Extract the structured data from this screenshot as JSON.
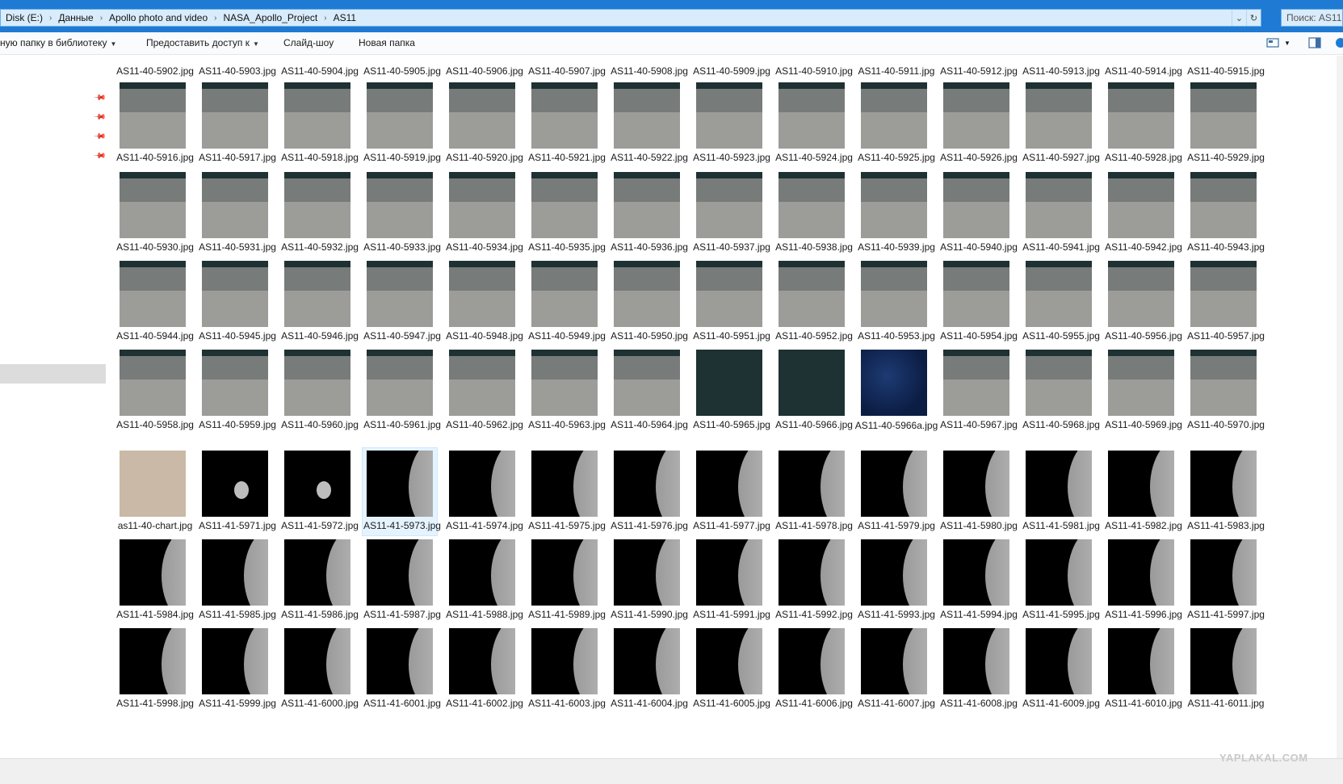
{
  "address": {
    "crumbs": [
      "Disk (E:)",
      "Данные",
      "Apollo photo and video",
      "NASA_Apollo_Project",
      "AS11"
    ],
    "search_placeholder": "Поиск: AS11"
  },
  "toolbar": {
    "include_library": "ную папку в библиотеку",
    "share": "Предоставить доступ к",
    "slideshow": "Слайд-шоу",
    "new_folder": "Новая папка"
  },
  "rows": [
    {
      "files": [
        "AS11-40-5902.jpg",
        "AS11-40-5903.jpg",
        "AS11-40-5904.jpg",
        "AS11-40-5905.jpg",
        "AS11-40-5906.jpg",
        "AS11-40-5907.jpg",
        "AS11-40-5908.jpg",
        "AS11-40-5909.jpg",
        "AS11-40-5910.jpg",
        "AS11-40-5911.jpg",
        "AS11-40-5912.jpg",
        "AS11-40-5913.jpg",
        "AS11-40-5914.jpg",
        "AS11-40-5915.jpg"
      ],
      "kind": "lunar"
    },
    {
      "files": [
        "AS11-40-5916.jpg",
        "AS11-40-5917.jpg",
        "AS11-40-5918.jpg",
        "AS11-40-5919.jpg",
        "AS11-40-5920.jpg",
        "AS11-40-5921.jpg",
        "AS11-40-5922.jpg",
        "AS11-40-5923.jpg",
        "AS11-40-5924.jpg",
        "AS11-40-5925.jpg",
        "AS11-40-5926.jpg",
        "AS11-40-5927.jpg",
        "AS11-40-5928.jpg",
        "AS11-40-5929.jpg"
      ],
      "kind": "lunar"
    },
    {
      "files": [
        "AS11-40-5930.jpg",
        "AS11-40-5931.jpg",
        "AS11-40-5932.jpg",
        "AS11-40-5933.jpg",
        "AS11-40-5934.jpg",
        "AS11-40-5935.jpg",
        "AS11-40-5936.jpg",
        "AS11-40-5937.jpg",
        "AS11-40-5938.jpg",
        "AS11-40-5939.jpg",
        "AS11-40-5940.jpg",
        "AS11-40-5941.jpg",
        "AS11-40-5942.jpg",
        "AS11-40-5943.jpg"
      ],
      "kind": "lunar"
    },
    {
      "files": [
        "AS11-40-5944.jpg",
        "AS11-40-5945.jpg",
        "AS11-40-5946.jpg",
        "AS11-40-5947.jpg",
        "AS11-40-5948.jpg",
        "AS11-40-5949.jpg",
        "AS11-40-5950.jpg",
        "AS11-40-5951.jpg",
        "AS11-40-5952.jpg",
        "AS11-40-5953.jpg",
        "AS11-40-5954.jpg",
        "AS11-40-5955.jpg",
        "AS11-40-5956.jpg",
        "AS11-40-5957.jpg"
      ],
      "kind": "lunar"
    },
    {
      "files": [
        "AS11-40-5958.jpg",
        "AS11-40-5959.jpg",
        "AS11-40-5960.jpg",
        "AS11-40-5961.jpg",
        "AS11-40-5962.jpg",
        "AS11-40-5963.jpg",
        "AS11-40-5964.jpg",
        "AS11-40-5965.jpg",
        "AS11-40-5966.jpg",
        "AS11-40-5966a.jpg",
        "AS11-40-5967.jpg",
        "AS11-40-5968.jpg",
        "AS11-40-5969.jpg",
        "AS11-40-5970.jpg"
      ],
      "kind": "lunar"
    },
    {
      "files": [
        "as11-40-chart.jpg",
        "AS11-41-5971.jpg",
        "AS11-41-5972.jpg",
        "AS11-41-5973.jpg",
        "AS11-41-5974.jpg",
        "AS11-41-5975.jpg",
        "AS11-41-5976.jpg",
        "AS11-41-5977.jpg",
        "AS11-41-5978.jpg",
        "AS11-41-5979.jpg",
        "AS11-41-5980.jpg",
        "AS11-41-5981.jpg",
        "AS11-41-5982.jpg",
        "AS11-41-5983.jpg"
      ],
      "kind": "black"
    },
    {
      "files": [
        "AS11-41-5984.jpg",
        "AS11-41-5985.jpg",
        "AS11-41-5986.jpg",
        "AS11-41-5987.jpg",
        "AS11-41-5988.jpg",
        "AS11-41-5989.jpg",
        "AS11-41-5990.jpg",
        "AS11-41-5991.jpg",
        "AS11-41-5992.jpg",
        "AS11-41-5993.jpg",
        "AS11-41-5994.jpg",
        "AS11-41-5995.jpg",
        "AS11-41-5996.jpg",
        "AS11-41-5997.jpg"
      ],
      "kind": "black"
    },
    {
      "files": [
        "AS11-41-5998.jpg",
        "AS11-41-5999.jpg",
        "AS11-41-6000.jpg",
        "AS11-41-6001.jpg",
        "AS11-41-6002.jpg",
        "AS11-41-6003.jpg",
        "AS11-41-6004.jpg",
        "AS11-41-6005.jpg",
        "AS11-41-6006.jpg",
        "AS11-41-6007.jpg",
        "AS11-41-6008.jpg",
        "AS11-41-6009.jpg",
        "AS11-41-6010.jpg",
        "AS11-41-6011.jpg"
      ],
      "kind": "black"
    }
  ],
  "selected_file": "AS11-41-5973.jpg",
  "watermark": "YAPLAKAL.COM",
  "colors": {
    "accent": "#1f7ad4",
    "selection": "#e5f3ff"
  }
}
